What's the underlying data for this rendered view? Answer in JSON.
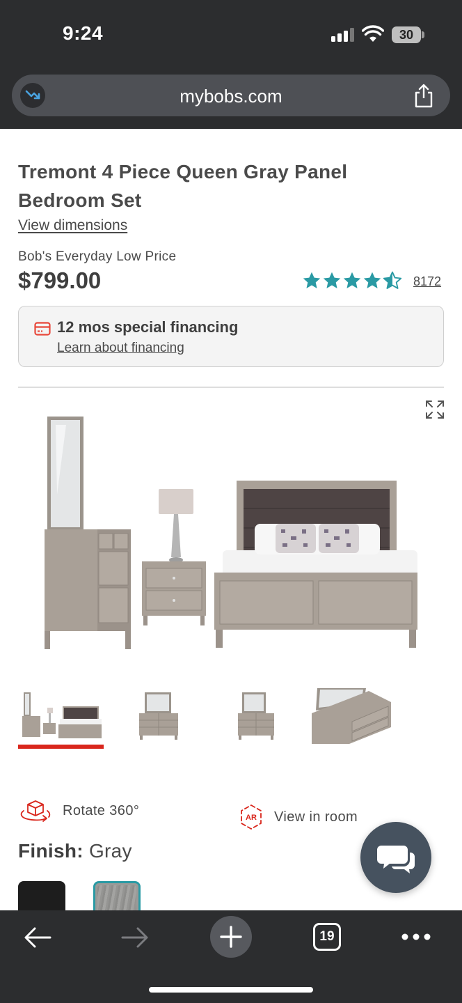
{
  "status_bar": {
    "time": "9:24",
    "battery": "30",
    "icons": [
      "signal-icon",
      "wifi-icon",
      "battery-icon"
    ]
  },
  "browser": {
    "url": "mybobs.com",
    "tab_count": "19",
    "icons": [
      "trend-icon",
      "share-icon",
      "back-arrow-icon",
      "forward-arrow-icon",
      "plus-icon",
      "tabs-icon",
      "more-icon"
    ]
  },
  "product": {
    "title": "Tremont 4 Piece Queen Gray Panel Bedroom Set",
    "view_dimensions": "View dimensions",
    "price_label": "Bob's Everyday Low Price",
    "price": "$799.00",
    "rating": 4.5,
    "rating_max": 5,
    "review_count": "8172",
    "star_color": "#2a9aa4"
  },
  "financing": {
    "title": "12 mos special financing",
    "link": "Learn about financing",
    "icon": "credit-card-icon",
    "icon_color": "#e8483b"
  },
  "gallery": {
    "selected_index": 0,
    "thumbnails": [
      "bedroom-set",
      "dresser-mirror-front",
      "dresser-mirror-angle",
      "dresser-closeup"
    ],
    "accent_color": "#d9261c"
  },
  "actions": {
    "rotate_label": "Rotate 360°",
    "view_in_room_label": "View in room"
  },
  "finish": {
    "label": "Finish:",
    "value": "Gray",
    "swatches": [
      {
        "name": "Black",
        "color": "#1d1d1d",
        "selected": false
      },
      {
        "name": "Gray",
        "color": "#9a9a98",
        "selected": true
      }
    ],
    "selected_border_color": "#2a9aa4"
  },
  "chat": {
    "icon": "chat-bubbles-icon",
    "color": "#46525f"
  }
}
